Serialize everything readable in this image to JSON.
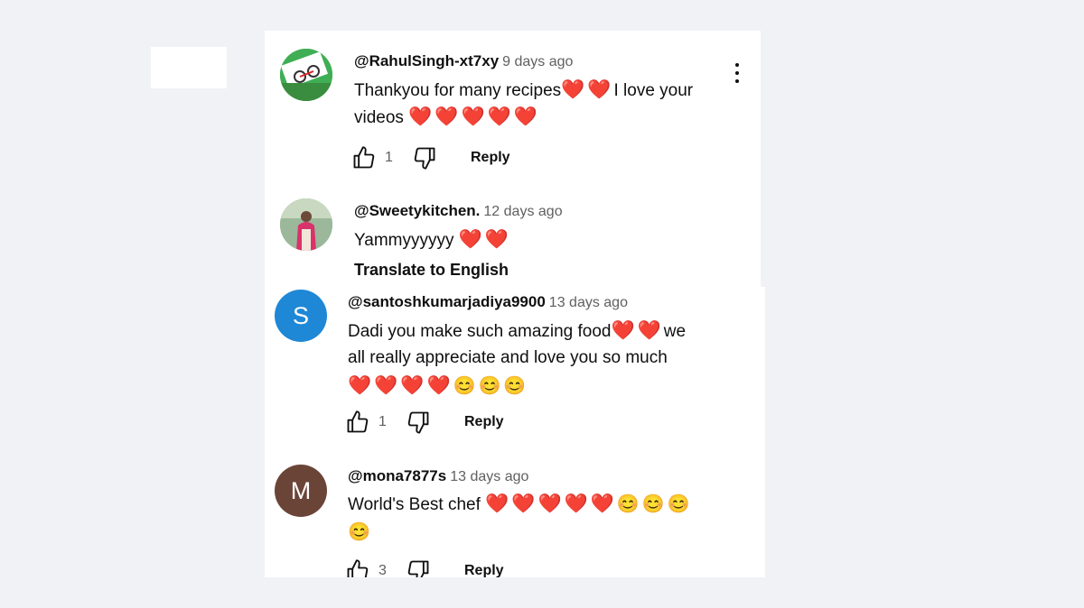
{
  "comments": [
    {
      "author": "@RahulSingh-xt7xy",
      "time": "9 days ago",
      "line1": "Thankyou for many recipes",
      "line1_hearts": "❤️❤️",
      "line1_tail": "I love your",
      "line2": "videos",
      "line2_emoji": "❤️❤️❤️❤️❤️",
      "likes": "1",
      "reply": "Reply"
    },
    {
      "author": "@Sweetykitchen.",
      "time": "12 days ago",
      "line1": "Yammyyyyyy",
      "line1_emoji": "❤️❤️",
      "translate": "Translate to English"
    },
    {
      "author": "@santoshkumarjadiya9900",
      "time": "13 days ago",
      "avatar_letter": "S",
      "line1": "Dadi you make such amazing food",
      "line1_hearts": "❤️❤️",
      "line1_tail": "we",
      "line2": "all really appreciate and love you so much",
      "line3_hearts": "❤️❤️❤️❤️",
      "line3_smileys": "😊😊😊",
      "likes": "1",
      "reply": "Reply"
    },
    {
      "author": "@mona7877s",
      "time": "13 days ago",
      "avatar_letter": "M",
      "line1": "World's Best chef",
      "line1_hearts": "❤️❤️❤️❤️❤️",
      "line1_smileys": "😊😊😊",
      "line2_smileys": "😊",
      "likes": "3",
      "reply": "Reply"
    }
  ],
  "colors": {
    "page_bg": "#f1f2f6",
    "panel_bg": "#ffffff",
    "avatar_s": "#1e88d6",
    "avatar_m": "#6b4438",
    "avatar_rahul": "#3fae54",
    "heart": "#e3263c"
  },
  "icons": [
    "like-icon",
    "dislike-icon",
    "more-vert-icon"
  ]
}
